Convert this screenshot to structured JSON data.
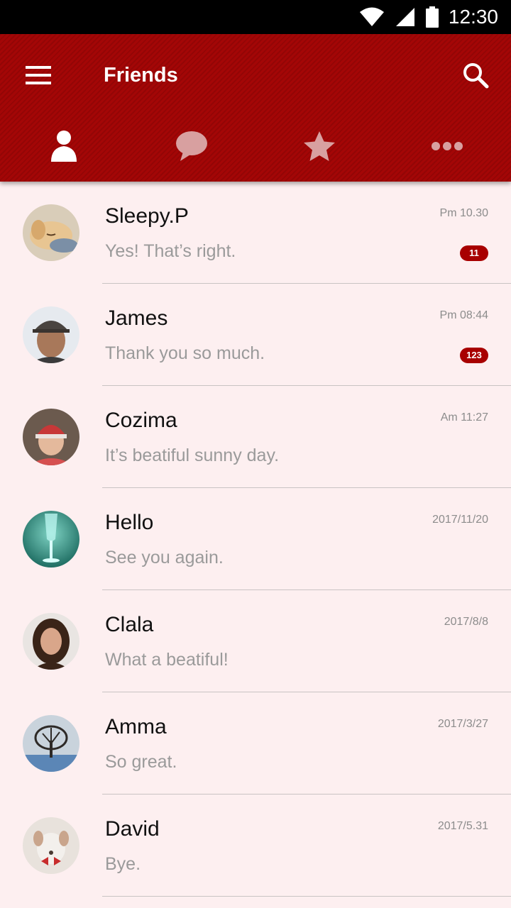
{
  "status_bar": {
    "time": "12:30",
    "icons": [
      "wifi-icon",
      "signal-icon",
      "battery-icon"
    ]
  },
  "header": {
    "title": "Friends",
    "accent_color": "#a40606",
    "tabs": [
      {
        "icon": "person-icon",
        "active": true
      },
      {
        "icon": "chat-bubble-icon",
        "active": false
      },
      {
        "icon": "star-icon",
        "active": false
      },
      {
        "icon": "more-dots-icon",
        "active": false
      }
    ]
  },
  "conversations": [
    {
      "name": "Sleepy.P",
      "message": "Yes! That’s right.",
      "time": "Pm 10.30",
      "badge": "11",
      "avatar": "sleeping-dog-avatar"
    },
    {
      "name": "James",
      "message": "Thank you so much.",
      "time": "Pm 08:44",
      "badge": "123",
      "avatar": "man-cap-avatar"
    },
    {
      "name": "Cozima",
      "message": "It’s beatiful sunny day.",
      "time": "Am 11:27",
      "badge": "",
      "avatar": "woman-beanie-avatar"
    },
    {
      "name": "Hello",
      "message": "See you again.",
      "time": "2017/11/20",
      "badge": "",
      "avatar": "glass-avatar"
    },
    {
      "name": "Clala",
      "message": "What a beatiful!",
      "time": "2017/8/8",
      "badge": "",
      "avatar": "woman-portrait-avatar"
    },
    {
      "name": "Amma",
      "message": "So great.",
      "time": "2017/3/27",
      "badge": "",
      "avatar": "tree-landscape-avatar"
    },
    {
      "name": "David",
      "message": "Bye.",
      "time": "2017/5.31",
      "badge": "",
      "avatar": "puppy-avatar"
    }
  ]
}
